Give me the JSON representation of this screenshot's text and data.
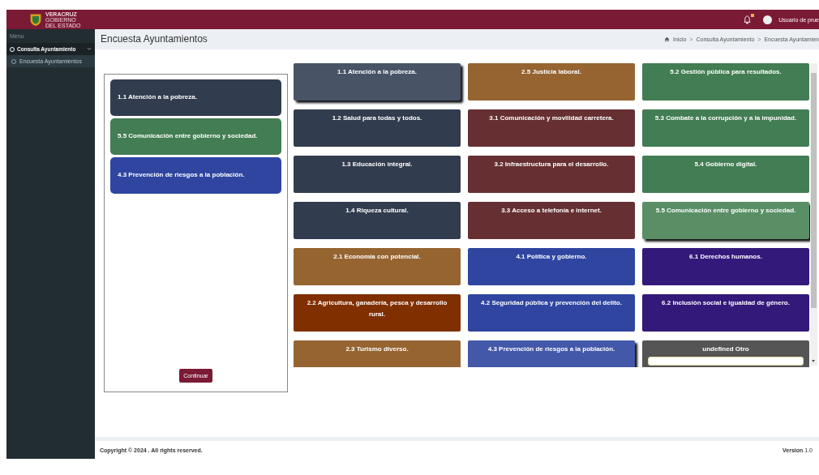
{
  "header": {
    "logo_lines": [
      "VERACRUZ",
      "GOBIERNO",
      "DEL ESTADO"
    ],
    "notifications": {
      "unread": true
    },
    "user": "Usuario de prue"
  },
  "sidebar": {
    "heading": "Menu",
    "items": [
      {
        "label": "Consulta Ayuntamiento",
        "expanded": true,
        "children": [
          {
            "label": "Encuesta Ayuntamientos",
            "selected": true
          }
        ]
      }
    ]
  },
  "page": {
    "title": "Encuesta Ayuntamientos",
    "breadcrumb": [
      "Inicio",
      "Consulta Ayuntamiento",
      "Encuesta Ayuntamien"
    ],
    "breadcrumb_separator": ">"
  },
  "chosen": [
    {
      "label": "1.1 Atención a la pobreza.",
      "color": "#323c4f"
    },
    {
      "label": "5.5 Comunicación entre gobierno y sociedad.",
      "color": "#437d53"
    },
    {
      "label": "4.3 Prevención de riesgos a la población.",
      "color": "#2f45a0"
    }
  ],
  "continue_button": "Continuar",
  "options": [
    {
      "label": "1.1 Atención a la pobreza.",
      "color": "#485466",
      "selected": true,
      "kind": "topic"
    },
    {
      "label": "2.5 Justicia laboral.",
      "color": "#956431",
      "selected": false,
      "kind": "topic"
    },
    {
      "label": "5.2 Gestión pública para resultados.",
      "color": "#437d53",
      "selected": false,
      "kind": "topic"
    },
    {
      "label": "1.2 Salud para todas y todos.",
      "color": "#323c4f",
      "selected": false,
      "kind": "topic"
    },
    {
      "label": "3.1 Comunicación y movilidad carretera.",
      "color": "#663032",
      "selected": false,
      "kind": "topic"
    },
    {
      "label": "5.3 Combate a la corrupción y a la impunidad.",
      "color": "#437d53",
      "selected": false,
      "kind": "topic"
    },
    {
      "label": "1.3 Educación integral.",
      "color": "#323c4f",
      "selected": false,
      "kind": "topic"
    },
    {
      "label": "3.2 Infraestructura para el desarrollo.",
      "color": "#663032",
      "selected": false,
      "kind": "topic"
    },
    {
      "label": "5.4 Gobierno digital.",
      "color": "#437d53",
      "selected": false,
      "kind": "topic"
    },
    {
      "label": "1.4 Riqueza cultural.",
      "color": "#323c4f",
      "selected": false,
      "kind": "topic"
    },
    {
      "label": "3.3 Acceso a telefonía e internet.",
      "color": "#663032",
      "selected": false,
      "kind": "topic"
    },
    {
      "label": "5.5 Comunicación entre gobierno y sociedad.",
      "color": "#5a8f66",
      "selected": true,
      "kind": "topic"
    },
    {
      "label": "2.1 Economía con potencial.",
      "color": "#956431",
      "selected": false,
      "kind": "topic"
    },
    {
      "label": "4.1 Política y gobierno.",
      "color": "#2f45a0",
      "selected": false,
      "kind": "topic"
    },
    {
      "label": "6.1 Derechos humanos.",
      "color": "#33197a",
      "selected": false,
      "kind": "topic"
    },
    {
      "label": "2.2 Agricultura, ganadería, pesca y desarrollo rural.",
      "color": "#7f2f00",
      "selected": false,
      "kind": "topic"
    },
    {
      "label": "4.2 Seguridad pública y prevención del delito.",
      "color": "#2f45a0",
      "selected": false,
      "kind": "topic"
    },
    {
      "label": "6.2 Inclusión social e igualdad de género.",
      "color": "#33197a",
      "selected": false,
      "kind": "topic"
    },
    {
      "label": "2.3 Turismo diverso.",
      "color": "#956431",
      "selected": false,
      "kind": "topic"
    },
    {
      "label": "4.3 Prevención de riesgos a la población.",
      "color": "#4458aa",
      "selected": true,
      "kind": "topic"
    },
    {
      "label": "undefined Otro",
      "color": "#555555",
      "selected": false,
      "kind": "other"
    }
  ],
  "footer": {
    "copyright": "Copyright © 2024 . All rights reserved.",
    "version_label": "Version",
    "version": "1.0"
  }
}
